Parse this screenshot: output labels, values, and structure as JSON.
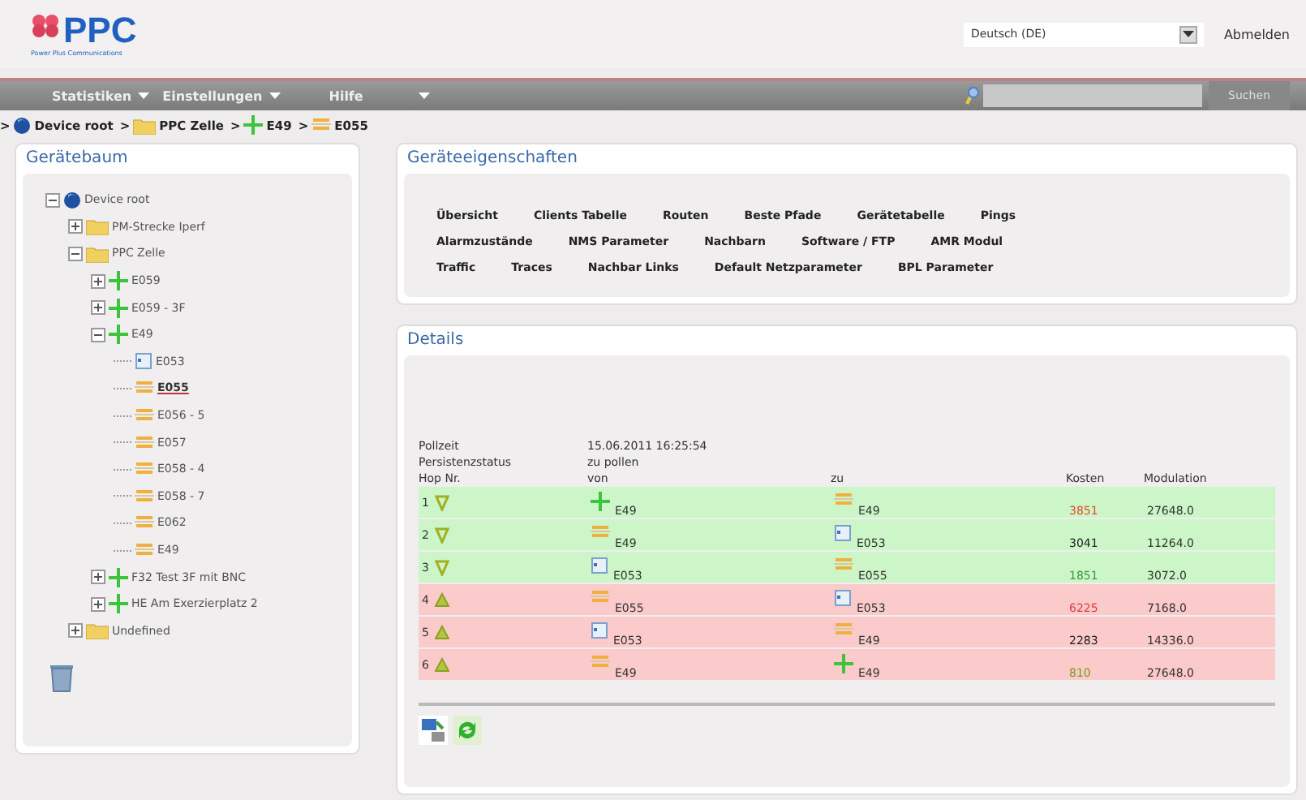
{
  "header": {
    "logo": "PPC",
    "tagline": "Power Plus Communications",
    "language": "Deutsch (DE)",
    "logout": "Abmelden"
  },
  "menu": [
    {
      "label": "Statistiken"
    },
    {
      "label": "Einstellungen"
    },
    {
      "label": "Hilfe"
    }
  ],
  "search": {
    "button": "Suchen"
  },
  "breadcrumb": {
    "separator": ">",
    "items": [
      {
        "kind": "root",
        "label": "Device root"
      },
      {
        "kind": "folder",
        "label": "PPC Zelle"
      },
      {
        "kind": "plus",
        "label": "E49"
      },
      {
        "kind": "bar",
        "label": "E055"
      }
    ]
  },
  "device_tree": {
    "title": "Gerätebaum",
    "nodes": [
      {
        "kind": "root",
        "label": "Device root",
        "expanded": true,
        "selected": false,
        "children": [
          {
            "kind": "folder",
            "label": "PM-Strecke Iperf",
            "expanded": false,
            "selected": false
          },
          {
            "kind": "folder",
            "label": "PPC Zelle",
            "expanded": true,
            "selected": false,
            "children": [
              {
                "kind": "plus",
                "label": "E059",
                "expanded": false,
                "selected": false
              },
              {
                "kind": "plus",
                "label": "E059 - 3F",
                "expanded": false,
                "selected": false
              },
              {
                "kind": "plus",
                "label": "E49",
                "expanded": true,
                "selected": false,
                "children": [
                  {
                    "kind": "box",
                    "label": "E053",
                    "selected": false
                  },
                  {
                    "kind": "bar",
                    "label": "E055",
                    "selected": true
                  },
                  {
                    "kind": "bar",
                    "label": "E056 - 5",
                    "selected": false
                  },
                  {
                    "kind": "bar",
                    "label": "E057",
                    "selected": false
                  },
                  {
                    "kind": "bar",
                    "label": "E058 - 4",
                    "selected": false
                  },
                  {
                    "kind": "bar",
                    "label": "E058 - 7",
                    "selected": false
                  },
                  {
                    "kind": "bar",
                    "label": "E062",
                    "selected": false
                  },
                  {
                    "kind": "bar",
                    "label": "E49",
                    "selected": false
                  }
                ]
              },
              {
                "kind": "plus",
                "label": "F32 Test 3F mit BNC",
                "expanded": false,
                "selected": false
              },
              {
                "kind": "plus",
                "label": "HE Am Exerzierplatz 2",
                "expanded": false,
                "selected": false
              }
            ]
          },
          {
            "kind": "folder",
            "label": "Undefined",
            "expanded": false,
            "selected": false
          }
        ]
      }
    ]
  },
  "properties": {
    "title": "Geräteeigenschaften",
    "links": [
      [
        "Übersicht",
        "Clients Tabelle",
        "Routen",
        "Beste Pfade",
        "Gerätetabelle",
        "Pings"
      ],
      [
        "Alarmzustände",
        "NMS Parameter",
        "Nachbarn",
        "Software / FTP",
        "AMR Modul"
      ],
      [
        "Traffic",
        "Traces",
        "Nachbar Links",
        "Default Netzparameter",
        "BPL Parameter"
      ]
    ]
  },
  "details": {
    "title": "Details",
    "poll_time_label": "Pollzeit",
    "poll_time": "15.06.2011 16:25:54",
    "persistence_label": "Persistenzstatus",
    "persistence": "zu pollen",
    "columns": [
      "Hop Nr.",
      "von",
      "zu",
      "Kosten",
      "Modulation"
    ],
    "rows": [
      {
        "hop": "1",
        "alarm": false,
        "from": {
          "kind": "plus",
          "label": "E49"
        },
        "to": {
          "kind": "bar",
          "label": "E49"
        },
        "cost": "3851",
        "color": "#e0502a",
        "modulation": "27648.0"
      },
      {
        "hop": "2",
        "alarm": false,
        "from": {
          "kind": "bar",
          "label": "E49"
        },
        "to": {
          "kind": "box",
          "label": "E053"
        },
        "cost": "3041",
        "color": "#222222",
        "modulation": "11264.0"
      },
      {
        "hop": "3",
        "alarm": false,
        "from": {
          "kind": "box",
          "label": "E053"
        },
        "to": {
          "kind": "bar",
          "label": "E055"
        },
        "cost": "1851",
        "color": "#3c9a3c",
        "modulation": "3072.0"
      },
      {
        "hop": "4",
        "alarm": true,
        "from": {
          "kind": "bar",
          "label": "E055"
        },
        "to": {
          "kind": "box",
          "label": "E053"
        },
        "cost": "6225",
        "color": "#e03a3a",
        "modulation": "7168.0"
      },
      {
        "hop": "5",
        "alarm": true,
        "from": {
          "kind": "box",
          "label": "E053"
        },
        "to": {
          "kind": "bar",
          "label": "E49"
        },
        "cost": "2283",
        "color": "#222222",
        "modulation": "14336.0"
      },
      {
        "hop": "6",
        "alarm": true,
        "from": {
          "kind": "bar",
          "label": "E49"
        },
        "to": {
          "kind": "plus",
          "label": "E49"
        },
        "cost": "810",
        "color": "#7a9a20",
        "modulation": "27648.0"
      }
    ]
  }
}
